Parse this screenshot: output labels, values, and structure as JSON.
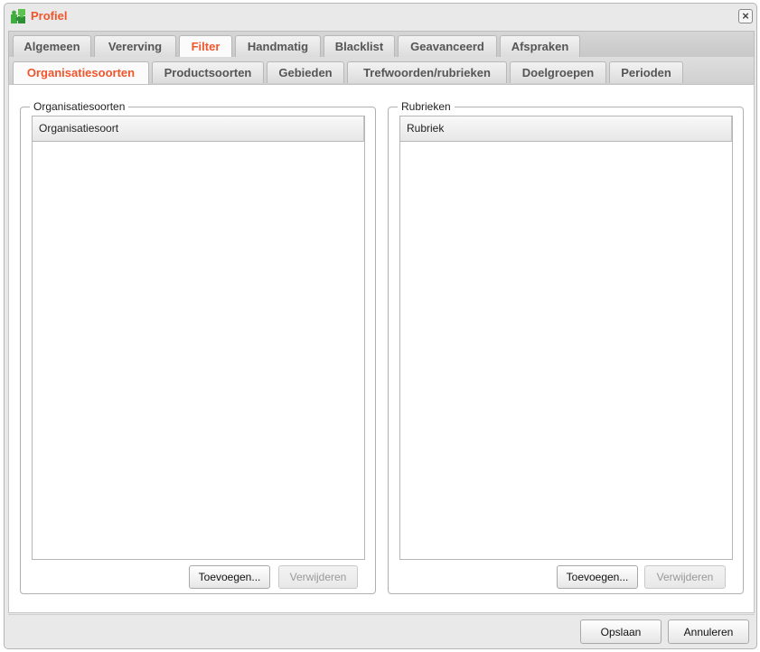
{
  "window": {
    "title": "Profiel"
  },
  "tabs_main": [
    "Algemeen",
    "Vererving",
    "Filter",
    "Handmatig",
    "Blacklist",
    "Geavanceerd",
    "Afspraken"
  ],
  "tabs_main_active": "Filter",
  "tabs_sub": [
    "Organisatiesoorten",
    "Productsoorten",
    "Gebieden",
    "Trefwoorden/rubrieken",
    "Doelgroepen",
    "Perioden"
  ],
  "tabs_sub_active": "Organisatiesoorten",
  "left_panel": {
    "legend": "Organisatiesoorten",
    "column_header": "Organisatiesoort",
    "add_label": "Toevoegen...",
    "remove_label": "Verwijderen"
  },
  "right_panel": {
    "legend": "Rubrieken",
    "column_header": "Rubriek",
    "add_label": "Toevoegen...",
    "remove_label": "Verwijderen"
  },
  "footer": {
    "save_label": "Opslaan",
    "cancel_label": "Annuleren"
  },
  "colors": {
    "accent": "#f0552b",
    "icon_green": "#3fae3f"
  },
  "icons": {
    "app": "puzzle-icon",
    "close": "close-icon"
  }
}
